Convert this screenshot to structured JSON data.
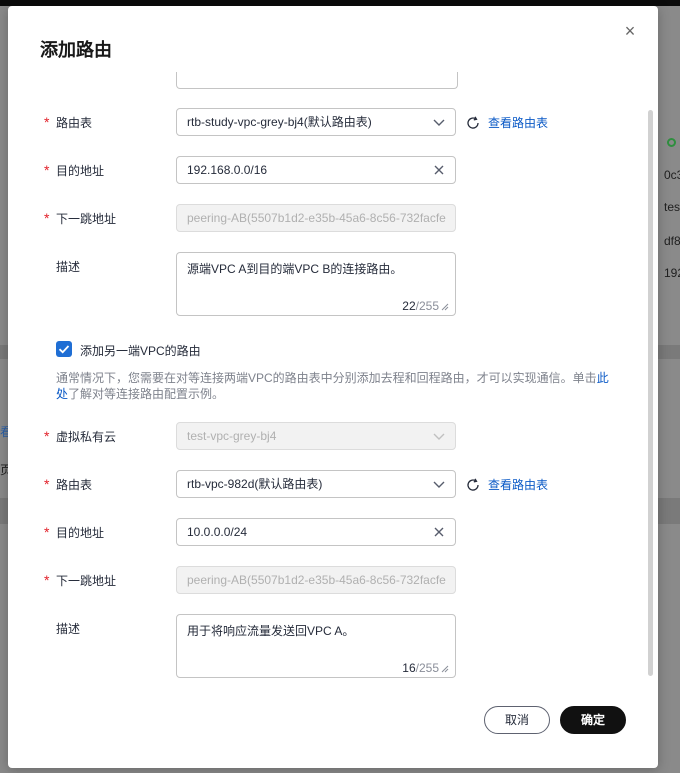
{
  "background": {
    "left_link": "看",
    "left_text": "页",
    "right_rows": [
      "0c3",
      "tes",
      "df8",
      "192"
    ]
  },
  "modal": {
    "title": "添加路由",
    "close_label": "×"
  },
  "route1": {
    "route_table_label": "路由表",
    "route_table_value": "rtb-study-vpc-grey-bj4(默认路由表)",
    "view_route_table": "查看路由表",
    "destination_label": "目的地址",
    "destination_value": "192.168.0.0/16",
    "next_hop_label": "下一跳地址",
    "next_hop_value": "peering-AB(5507b1d2-e35b-45a6-8c56-732facfe",
    "description_label": "描述",
    "description_value": "源端VPC A到目的端VPC B的连接路由。",
    "description_count": "22",
    "description_max": "/255"
  },
  "other_end": {
    "checkbox_label": "添加另一端VPC的路由",
    "checked": true,
    "note_text": "通常情况下，您需要在对等连接两端VPC的路由表中分别添加去程和回程路由，才可以实现通信。单击",
    "note_link": "此处",
    "note_tail": "了解对等连接路由配置示例。"
  },
  "route2": {
    "vpc_label": "虚拟私有云",
    "vpc_value": "test-vpc-grey-bj4",
    "route_table_label": "路由表",
    "route_table_value": "rtb-vpc-982d(默认路由表)",
    "view_route_table": "查看路由表",
    "destination_label": "目的地址",
    "destination_value": "10.0.0.0/24",
    "next_hop_label": "下一跳地址",
    "next_hop_value": "peering-AB(5507b1d2-e35b-45a6-8c56-732facfe",
    "description_label": "描述",
    "description_value": "用于将响应流量发送回VPC A。",
    "description_count": "16",
    "description_max": "/255"
  },
  "footer": {
    "cancel_label": "取消",
    "ok_label": "确定"
  },
  "colors": {
    "primary": "#0a59c6",
    "required": "#e2212a",
    "checkbox": "#1f6ed4",
    "confirm_button": "#111111"
  }
}
